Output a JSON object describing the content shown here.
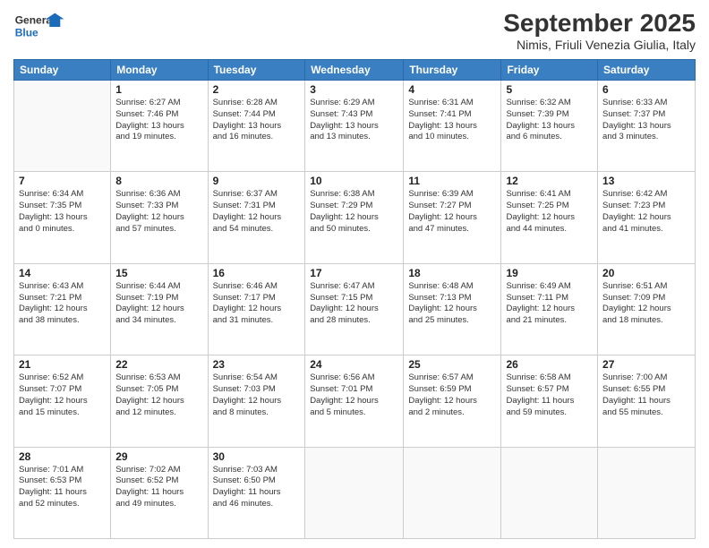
{
  "header": {
    "logo_line1": "General",
    "logo_line2": "Blue",
    "month_title": "September 2025",
    "location": "Nimis, Friuli Venezia Giulia, Italy"
  },
  "weekdays": [
    "Sunday",
    "Monday",
    "Tuesday",
    "Wednesday",
    "Thursday",
    "Friday",
    "Saturday"
  ],
  "weeks": [
    [
      {
        "day": "",
        "info": ""
      },
      {
        "day": "1",
        "info": "Sunrise: 6:27 AM\nSunset: 7:46 PM\nDaylight: 13 hours\nand 19 minutes."
      },
      {
        "day": "2",
        "info": "Sunrise: 6:28 AM\nSunset: 7:44 PM\nDaylight: 13 hours\nand 16 minutes."
      },
      {
        "day": "3",
        "info": "Sunrise: 6:29 AM\nSunset: 7:43 PM\nDaylight: 13 hours\nand 13 minutes."
      },
      {
        "day": "4",
        "info": "Sunrise: 6:31 AM\nSunset: 7:41 PM\nDaylight: 13 hours\nand 10 minutes."
      },
      {
        "day": "5",
        "info": "Sunrise: 6:32 AM\nSunset: 7:39 PM\nDaylight: 13 hours\nand 6 minutes."
      },
      {
        "day": "6",
        "info": "Sunrise: 6:33 AM\nSunset: 7:37 PM\nDaylight: 13 hours\nand 3 minutes."
      }
    ],
    [
      {
        "day": "7",
        "info": "Sunrise: 6:34 AM\nSunset: 7:35 PM\nDaylight: 13 hours\nand 0 minutes."
      },
      {
        "day": "8",
        "info": "Sunrise: 6:36 AM\nSunset: 7:33 PM\nDaylight: 12 hours\nand 57 minutes."
      },
      {
        "day": "9",
        "info": "Sunrise: 6:37 AM\nSunset: 7:31 PM\nDaylight: 12 hours\nand 54 minutes."
      },
      {
        "day": "10",
        "info": "Sunrise: 6:38 AM\nSunset: 7:29 PM\nDaylight: 12 hours\nand 50 minutes."
      },
      {
        "day": "11",
        "info": "Sunrise: 6:39 AM\nSunset: 7:27 PM\nDaylight: 12 hours\nand 47 minutes."
      },
      {
        "day": "12",
        "info": "Sunrise: 6:41 AM\nSunset: 7:25 PM\nDaylight: 12 hours\nand 44 minutes."
      },
      {
        "day": "13",
        "info": "Sunrise: 6:42 AM\nSunset: 7:23 PM\nDaylight: 12 hours\nand 41 minutes."
      }
    ],
    [
      {
        "day": "14",
        "info": "Sunrise: 6:43 AM\nSunset: 7:21 PM\nDaylight: 12 hours\nand 38 minutes."
      },
      {
        "day": "15",
        "info": "Sunrise: 6:44 AM\nSunset: 7:19 PM\nDaylight: 12 hours\nand 34 minutes."
      },
      {
        "day": "16",
        "info": "Sunrise: 6:46 AM\nSunset: 7:17 PM\nDaylight: 12 hours\nand 31 minutes."
      },
      {
        "day": "17",
        "info": "Sunrise: 6:47 AM\nSunset: 7:15 PM\nDaylight: 12 hours\nand 28 minutes."
      },
      {
        "day": "18",
        "info": "Sunrise: 6:48 AM\nSunset: 7:13 PM\nDaylight: 12 hours\nand 25 minutes."
      },
      {
        "day": "19",
        "info": "Sunrise: 6:49 AM\nSunset: 7:11 PM\nDaylight: 12 hours\nand 21 minutes."
      },
      {
        "day": "20",
        "info": "Sunrise: 6:51 AM\nSunset: 7:09 PM\nDaylight: 12 hours\nand 18 minutes."
      }
    ],
    [
      {
        "day": "21",
        "info": "Sunrise: 6:52 AM\nSunset: 7:07 PM\nDaylight: 12 hours\nand 15 minutes."
      },
      {
        "day": "22",
        "info": "Sunrise: 6:53 AM\nSunset: 7:05 PM\nDaylight: 12 hours\nand 12 minutes."
      },
      {
        "day": "23",
        "info": "Sunrise: 6:54 AM\nSunset: 7:03 PM\nDaylight: 12 hours\nand 8 minutes."
      },
      {
        "day": "24",
        "info": "Sunrise: 6:56 AM\nSunset: 7:01 PM\nDaylight: 12 hours\nand 5 minutes."
      },
      {
        "day": "25",
        "info": "Sunrise: 6:57 AM\nSunset: 6:59 PM\nDaylight: 12 hours\nand 2 minutes."
      },
      {
        "day": "26",
        "info": "Sunrise: 6:58 AM\nSunset: 6:57 PM\nDaylight: 11 hours\nand 59 minutes."
      },
      {
        "day": "27",
        "info": "Sunrise: 7:00 AM\nSunset: 6:55 PM\nDaylight: 11 hours\nand 55 minutes."
      }
    ],
    [
      {
        "day": "28",
        "info": "Sunrise: 7:01 AM\nSunset: 6:53 PM\nDaylight: 11 hours\nand 52 minutes."
      },
      {
        "day": "29",
        "info": "Sunrise: 7:02 AM\nSunset: 6:52 PM\nDaylight: 11 hours\nand 49 minutes."
      },
      {
        "day": "30",
        "info": "Sunrise: 7:03 AM\nSunset: 6:50 PM\nDaylight: 11 hours\nand 46 minutes."
      },
      {
        "day": "",
        "info": ""
      },
      {
        "day": "",
        "info": ""
      },
      {
        "day": "",
        "info": ""
      },
      {
        "day": "",
        "info": ""
      }
    ]
  ]
}
